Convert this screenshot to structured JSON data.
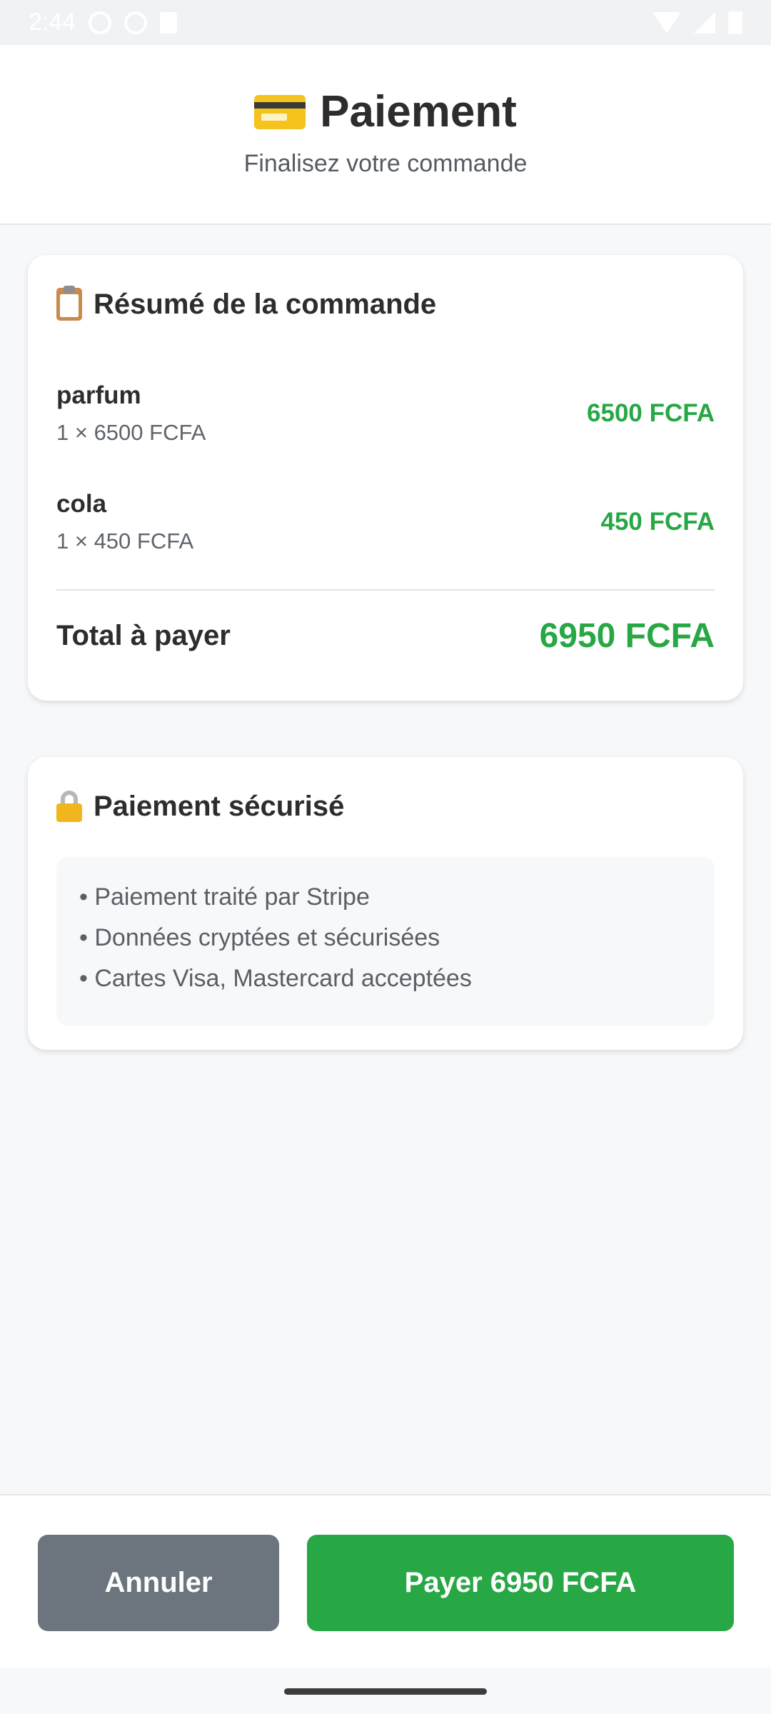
{
  "status_bar": {
    "time": "2:44"
  },
  "header": {
    "title": "Paiement",
    "subtitle": "Finalisez votre commande"
  },
  "summary": {
    "title": "Résumé de la commande",
    "items": [
      {
        "name": "parfum",
        "qty_line": "1 × 6500 FCFA",
        "price": "6500 FCFA"
      },
      {
        "name": "cola",
        "qty_line": "1 × 450 FCFA",
        "price": "450 FCFA"
      }
    ],
    "total_label": "Total à payer",
    "total_value": "6950 FCFA"
  },
  "security": {
    "title": "Paiement sécurisé",
    "lines": [
      "• Paiement traité par Stripe",
      "• Données cryptées et sécurisées",
      "• Cartes Visa, Mastercard acceptées"
    ]
  },
  "buttons": {
    "cancel": "Annuler",
    "pay": "Payer 6950 FCFA"
  },
  "colors": {
    "accent_green": "#28a745",
    "cancel_gray": "#6c757d"
  },
  "icons": {
    "header": "credit-card-icon",
    "summary": "clipboard-icon",
    "security": "lock-icon"
  }
}
